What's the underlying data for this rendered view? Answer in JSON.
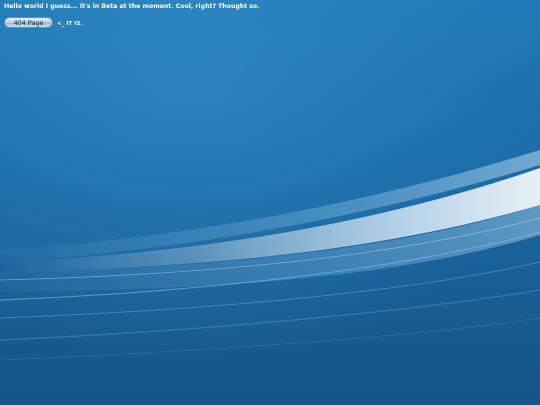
{
  "header": {
    "message": "Hello world I guess... it's in Beta at the moment. Cool, right? Thought so."
  },
  "nav": {
    "page_button_label": "404 Page",
    "note": "<_ IT IS."
  },
  "colors": {
    "background_top": "#1d73b0",
    "background_bottom": "#16558a",
    "text": "#ffffff",
    "button_fill": "#b9d2ea"
  }
}
